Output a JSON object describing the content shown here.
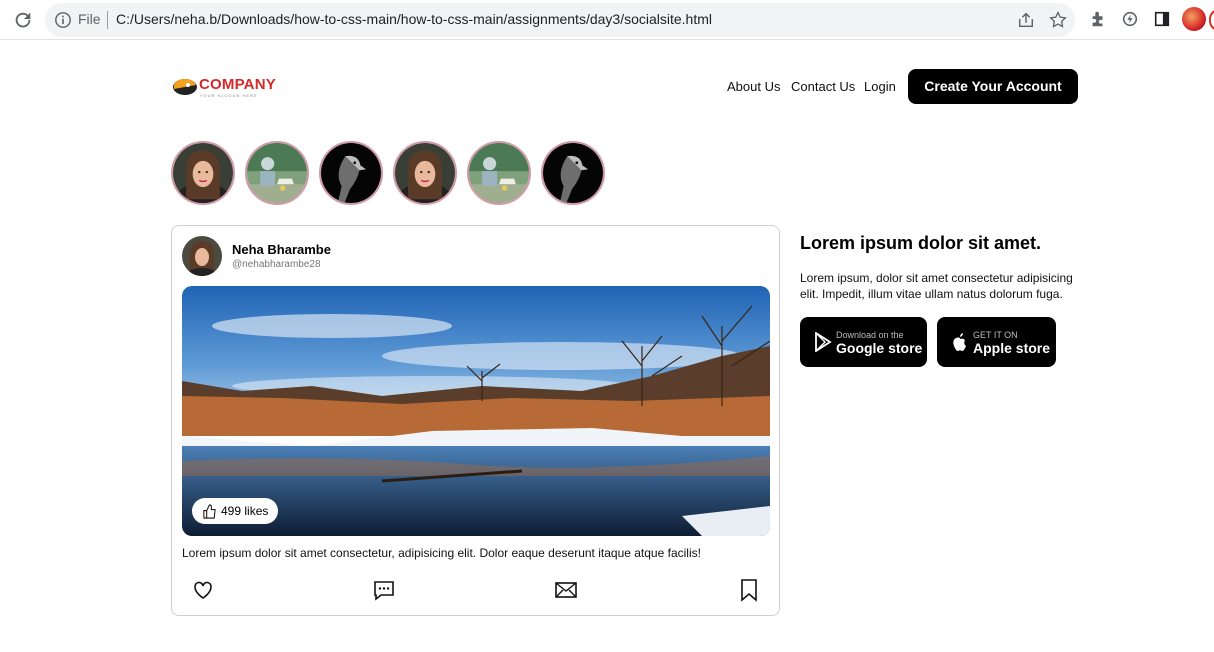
{
  "browser": {
    "file_label": "File",
    "url": "C:/Users/neha.b/Downloads/how-to-css-main/how-to-css-main/assignments/day3/socialsite.html"
  },
  "header": {
    "logo_text": "COMPANY",
    "logo_tagline": "YOUR SLOGAN HERE",
    "nav": [
      "About Us",
      "Contact Us",
      "Login"
    ],
    "cta_label": "Create Your Account"
  },
  "stories": [
    {
      "type": "woman-portrait"
    },
    {
      "type": "park-scene"
    },
    {
      "type": "eagle"
    },
    {
      "type": "woman-portrait"
    },
    {
      "type": "park-scene"
    },
    {
      "type": "eagle"
    }
  ],
  "post": {
    "author_name": "Neha Bharambe",
    "author_handle": "@nehabharambe28",
    "likes_label": "499 likes",
    "caption": "Lorem ipsum dolor sit amet consectetur, adipisicing elit. Dolor eaque deserunt itaque atque facilis!",
    "actions": [
      "heart-icon",
      "comment-icon",
      "mail-icon",
      "bookmark-icon"
    ]
  },
  "promo": {
    "title": "Lorem ipsum dolor sit amet.",
    "text": "Lorem ipsum, dolor sit amet consectetur adipisicing elit. Impedit, illum vitae ullam natus dolorum fuga.",
    "google": {
      "small": "Download on the",
      "big": "Google store"
    },
    "apple": {
      "small": "GET IT ON",
      "big": "Apple store"
    }
  },
  "colors": {
    "accent": "#000000",
    "brand": "#d62828",
    "story_ring": "#d199a8"
  }
}
